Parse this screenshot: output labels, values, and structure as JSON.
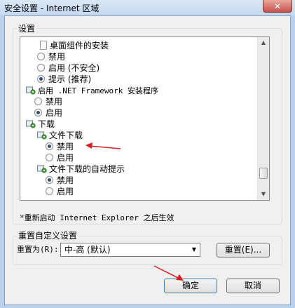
{
  "window": {
    "title": "安全设置 - Internet 区域",
    "close_glyph": "✕"
  },
  "settings": {
    "group_label": "设置",
    "items": [
      {
        "kind": "doc",
        "label": "桌面组件的安装"
      },
      {
        "kind": "radio",
        "label": "禁用",
        "checked": false
      },
      {
        "kind": "radio",
        "label": "启用 (不安全)",
        "checked": false
      },
      {
        "kind": "radio",
        "label": "提示 (推荐)",
        "checked": true
      },
      {
        "kind": "gear",
        "label": "启用 .NET Framework 安装程序"
      },
      {
        "kind": "radio",
        "label": "禁用",
        "checked": false
      },
      {
        "kind": "radio",
        "label": "启用",
        "checked": true
      },
      {
        "kind": "gear",
        "label": "下载"
      },
      {
        "kind": "gear",
        "label": "文件下载"
      },
      {
        "kind": "radio",
        "label": "禁用",
        "checked": true
      },
      {
        "kind": "radio",
        "label": "启用",
        "checked": false
      },
      {
        "kind": "gear",
        "label": "文件下载的自动提示"
      },
      {
        "kind": "radio",
        "label": "禁用",
        "checked": true
      },
      {
        "kind": "radio",
        "label": "启用",
        "checked": false
      }
    ],
    "footnote": "*重新启动 Internet Explorer 之后生效"
  },
  "reset": {
    "group_label": "重置自定义设置",
    "reset_to_label": "重置为(R):",
    "selected": "中-高 (默认)",
    "reset_button": "重置(E)..."
  },
  "buttons": {
    "ok": "确定",
    "cancel": "取消"
  },
  "colors": {
    "title_bg": "#c3d7ee",
    "close_red": "#c75050",
    "arrow_red": "#d62020",
    "radio_dot": "#2a4d7a"
  }
}
